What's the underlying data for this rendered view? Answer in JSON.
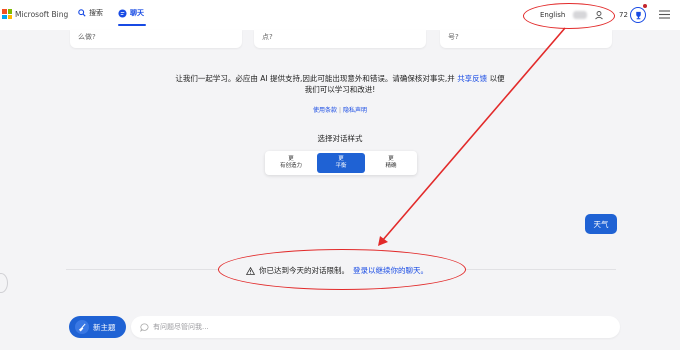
{
  "header": {
    "brand": "Microsoft Bing",
    "nav_search": "搜索",
    "nav_chat": "聊天",
    "language": "English",
    "points": "72"
  },
  "cards": [
    {
      "text": "么做?"
    },
    {
      "text": "点?"
    },
    {
      "text": "号?"
    }
  ],
  "disclaimer": {
    "line1": "让我们一起学习。必应由 AI 提供支持,因此可能出现意外和错误。请确保核对事实,并",
    "link": "共享反馈",
    "line1_end": "以便",
    "line2": "我们可以学习和改进!"
  },
  "terms": {
    "terms_link": "使用条款",
    "privacy_link": "隐私声明"
  },
  "conversation_style": {
    "title": "选择对话样式",
    "options": [
      {
        "top": "更",
        "bottom": "有创造力"
      },
      {
        "top": "更",
        "bottom": "平衡"
      },
      {
        "top": "更",
        "bottom": "精确"
      }
    ],
    "selected_index": 1
  },
  "messages": {
    "user_bubble": "天气"
  },
  "limit_notice": {
    "text": "你已达到今天的对话限制。",
    "link": "登录以继续你的聊天。"
  },
  "bottom": {
    "new_topic": "新主题",
    "input_placeholder": "有问题尽管问我..."
  },
  "colors": {
    "accent": "#174ae4",
    "button_blue": "#1f62d4",
    "annotation_red": "#e22a2a"
  }
}
